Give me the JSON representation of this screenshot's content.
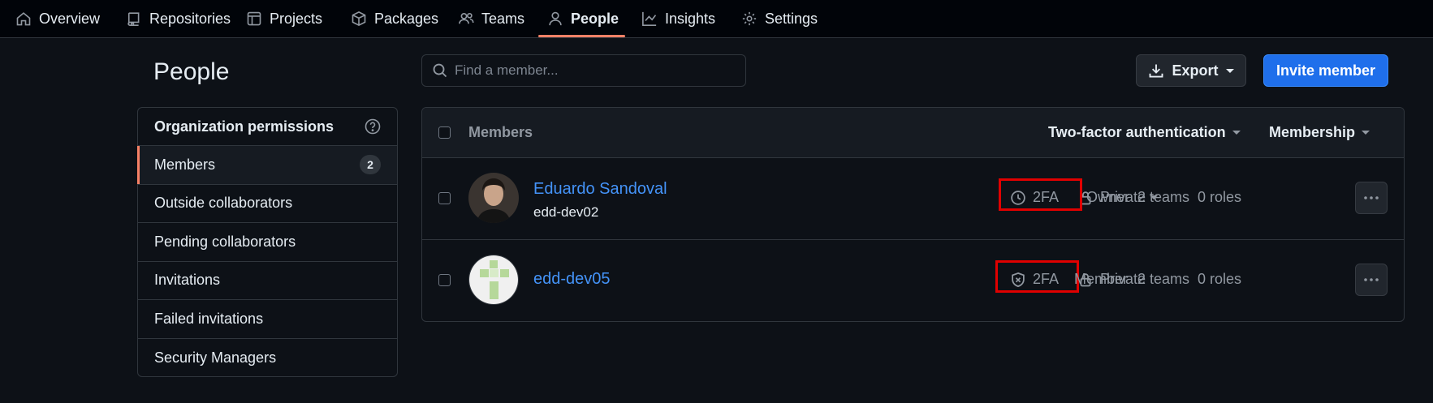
{
  "nav": {
    "items": [
      {
        "label": "Overview",
        "icon": "home-icon"
      },
      {
        "label": "Repositories",
        "icon": "repo-icon"
      },
      {
        "label": "Projects",
        "icon": "table-icon"
      },
      {
        "label": "Packages",
        "icon": "package-icon"
      },
      {
        "label": "Teams",
        "icon": "people-icon"
      },
      {
        "label": "People",
        "icon": "person-icon"
      },
      {
        "label": "Insights",
        "icon": "graph-icon"
      },
      {
        "label": "Settings",
        "icon": "gear-icon"
      }
    ],
    "active": "People"
  },
  "page": {
    "title": "People"
  },
  "sidebar": {
    "header": "Organization permissions",
    "items": [
      {
        "label": "Members",
        "count": "2"
      },
      {
        "label": "Outside collaborators"
      },
      {
        "label": "Pending collaborators"
      },
      {
        "label": "Invitations"
      },
      {
        "label": "Failed invitations"
      },
      {
        "label": "Security Managers"
      }
    ]
  },
  "search": {
    "placeholder": "Find a member..."
  },
  "actions": {
    "export_label": "Export",
    "invite_label": "Invite member"
  },
  "table": {
    "header": {
      "members_label": "Members",
      "twofa_filter": "Two-factor authentication",
      "membership_filter": "Membership"
    },
    "rows": [
      {
        "name": "Eduardo Sandoval",
        "login": "edd-dev02",
        "twofa": "2FA",
        "visibility": "Private",
        "role": "Owner",
        "teams": "2 teams",
        "roles": "0 roles"
      },
      {
        "name": "edd-dev05",
        "twofa": "2FA",
        "visibility": "Private",
        "role": "Member",
        "teams": "2 teams",
        "roles": "0 roles"
      }
    ]
  },
  "colors": {
    "accent": "#f78166",
    "link": "#4493f8",
    "primary": "#1f6feb",
    "highlight": "#e00000"
  }
}
